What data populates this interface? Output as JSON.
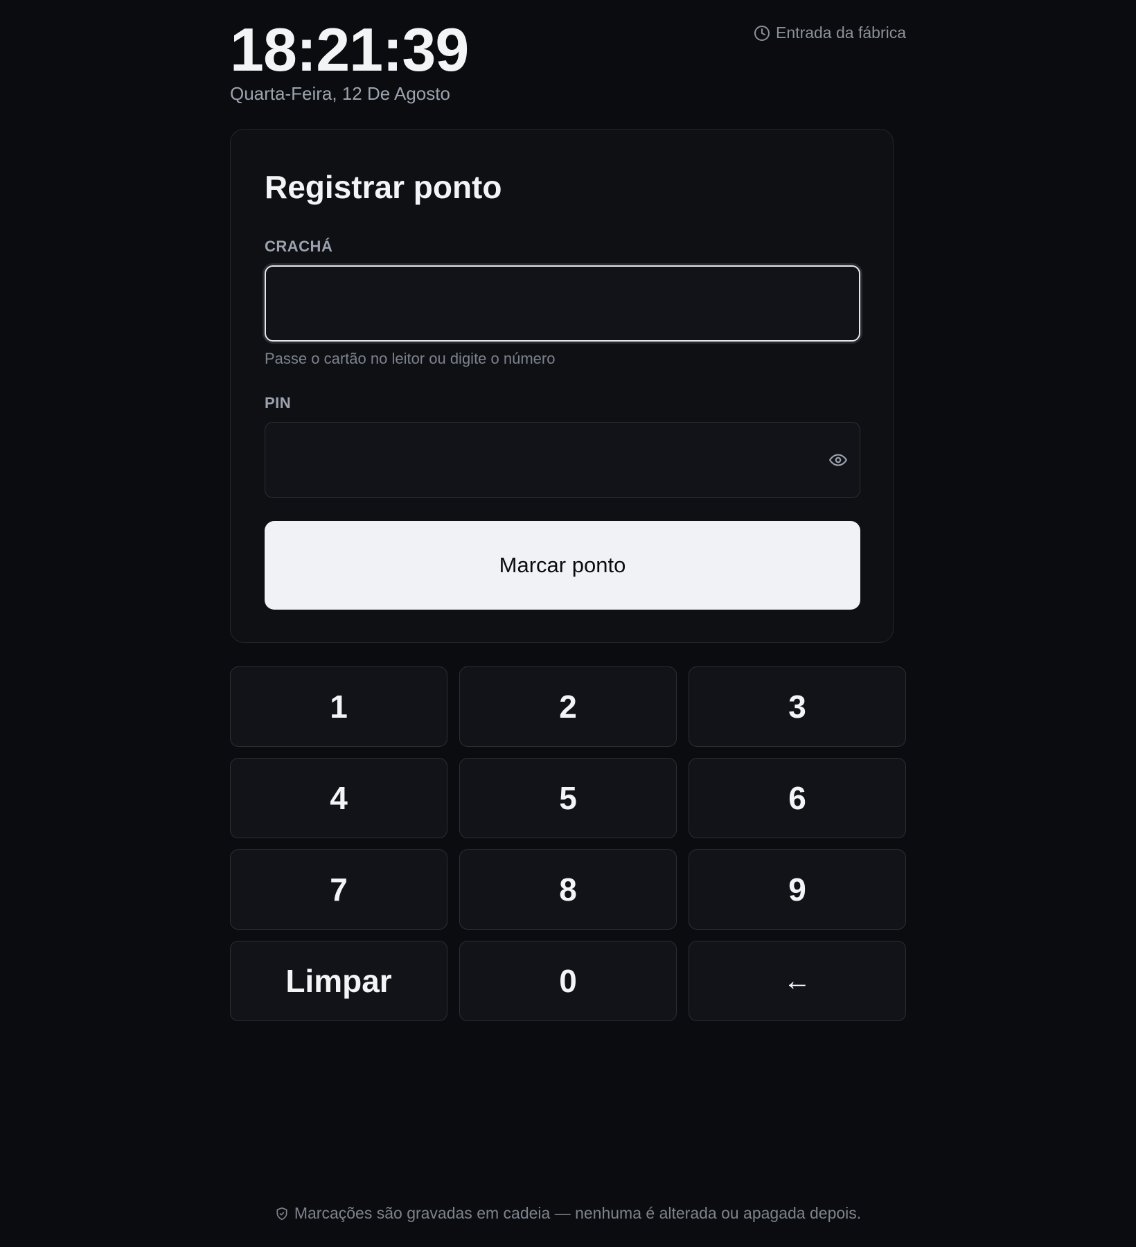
{
  "header": {
    "time": "18:21:39",
    "date": "Quarta-Feira, 12 De Agosto",
    "location": "Entrada da fábrica",
    "location_icon": "clock-icon"
  },
  "form": {
    "title": "Registrar ponto",
    "badge_label": "CRACHÁ",
    "badge_value": "",
    "badge_hint": "Passe o cartão no leitor ou digite o número",
    "pin_label": "PIN",
    "pin_value": "",
    "pin_toggle_icon": "eye-icon",
    "submit_label": "Marcar ponto"
  },
  "keypad": {
    "keys": [
      "1",
      "2",
      "3",
      "4",
      "5",
      "6",
      "7",
      "8",
      "9",
      "Limpar",
      "0",
      "←"
    ]
  },
  "footer": {
    "icon": "shield-icon",
    "text": "Marcações são gravadas em cadeia — nenhuma é alterada ou apagada depois."
  },
  "colors": {
    "background": "#0b0c0f",
    "card": "#0e1014",
    "button": "#f1f2f5",
    "muted_text": "#9ca3af"
  }
}
